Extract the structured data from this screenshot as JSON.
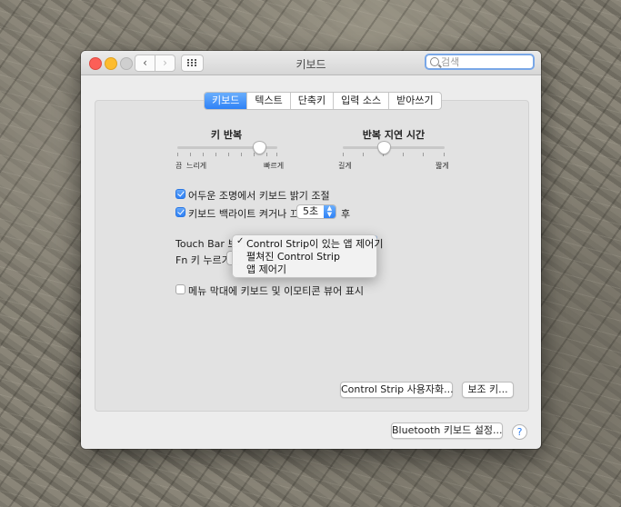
{
  "window": {
    "title": "키보드"
  },
  "search": {
    "placeholder": "검색"
  },
  "tabs": [
    {
      "label": "키보드",
      "active": true
    },
    {
      "label": "텍스트",
      "active": false
    },
    {
      "label": "단축키",
      "active": false
    },
    {
      "label": "입력 소스",
      "active": false
    },
    {
      "label": "받아쓰기",
      "active": false
    }
  ],
  "key_repeat": {
    "title": "키 반복",
    "left_label": "끔",
    "left_label2": "느리게",
    "right_label": "빠르게",
    "value_fraction": 0.82
  },
  "repeat_delay": {
    "title": "반복 지연 시간",
    "left_label": "길게",
    "right_label": "짧게",
    "value_fraction": 0.4
  },
  "options": {
    "dark_adjust": {
      "label": "어두운 조명에서 키보드 밝기 조절",
      "checked": true
    },
    "backlight_off": {
      "label": "키보드 백라이트 켜거나 끄기:",
      "checked": true,
      "value": "5초",
      "suffix": "후"
    },
    "menu_viewer": {
      "label": "메뉴 막대에 키보드 및 이모티콘 뷰어 표시",
      "checked": false
    }
  },
  "touchbar": {
    "label": "Touch Bar 보기:"
  },
  "fn_key": {
    "label": "Fn 키 누르기"
  },
  "menu": {
    "items": [
      {
        "label": "Control Strip이 있는 앱 제어기",
        "selected": true
      },
      {
        "label": "펼쳐진 Control Strip",
        "selected": false
      },
      {
        "label": "앱 제어기",
        "selected": false
      }
    ],
    "check_mark": "✓"
  },
  "buttons": {
    "customize": "Control Strip 사용자화...",
    "modifier": "보조 키...",
    "bluetooth": "Bluetooth 키보드 설정...",
    "help": "?"
  },
  "colors": {
    "accent": "#2f82f6",
    "close": "#fc5f57",
    "minimize": "#fdbc2e"
  }
}
